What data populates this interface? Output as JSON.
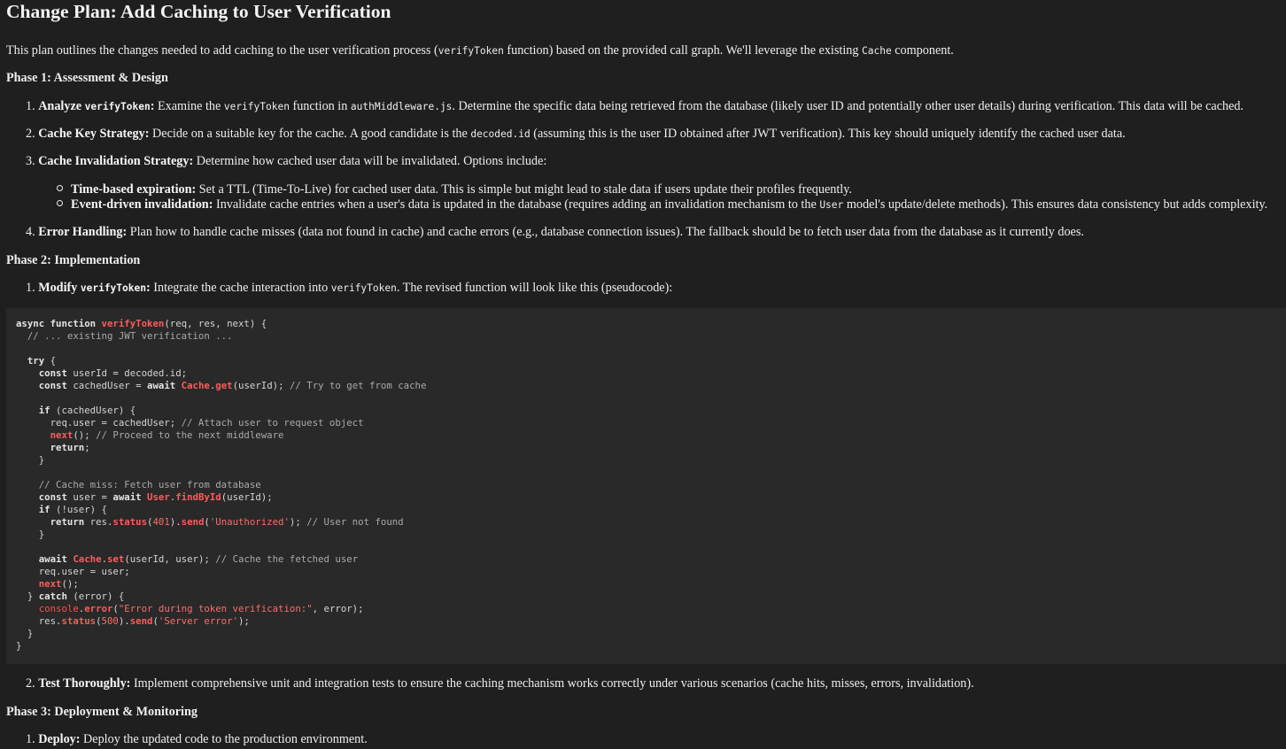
{
  "title": "Change Plan: Add Caching to User Verification",
  "intro": {
    "before": "This plan outlines the changes needed to add caching to the user verification process (",
    "code": "verifyToken",
    "after": " function) based on the provided call graph. We'll leverage the existing ",
    "code2": "Cache",
    "after2": " component."
  },
  "phase1": {
    "heading": "Phase 1: Assessment & Design",
    "items": [
      {
        "num": "1.",
        "label": "Analyze ",
        "label_code": "verifyToken",
        "label_end": ":",
        "t1": " Examine the ",
        "c1": "verifyToken",
        "t2": " function in ",
        "c2": "authMiddleware.js",
        "t3": ". Determine the specific data being retrieved from the database (likely user ID and potentially other user details) during verification. This data will be cached."
      },
      {
        "num": "2.",
        "label": "Cache Key Strategy:",
        "t1": " Decide on a suitable key for the cache. A good candidate is the ",
        "c1": "decoded.id",
        "t2": " (assuming this is the user ID obtained after JWT verification). This key should uniquely identify the cached user data."
      },
      {
        "num": "3.",
        "label": "Cache Invalidation Strategy:",
        "t1": " Determine how cached user data will be invalidated. Options include:",
        "bullets": [
          {
            "label": "Time-based expiration:",
            "text": " Set a TTL (Time-To-Live) for cached user data. This is simple but might lead to stale data if users update their profiles frequently."
          },
          {
            "label": "Event-driven invalidation:",
            "text": " Invalidate cache entries when a user's data is updated in the database (requires adding an invalidation mechanism to the ",
            "code": "User",
            "text2": " model's update/delete methods). This ensures data consistency but adds complexity."
          }
        ]
      },
      {
        "num": "4.",
        "label": "Error Handling:",
        "t1": " Plan how to handle cache misses (data not found in cache) and cache errors (e.g., database connection issues). The fallback should be to fetch user data from the database as it currently does."
      }
    ]
  },
  "phase2": {
    "heading": "Phase 2: Implementation",
    "item1": {
      "num": "1.",
      "label": "Modify ",
      "label_code": "verifyToken",
      "label_end": ":",
      "t1": " Integrate the cache interaction into ",
      "c1": "verifyToken",
      "t2": ". The revised function will look like this (pseudocode):"
    },
    "item2": {
      "num": "2.",
      "label": "Test Thoroughly:",
      "t1": " Implement comprehensive unit and integration tests to ensure the caching mechanism works correctly under various scenarios (cache hits, misses, errors, invalidation)."
    }
  },
  "phase3": {
    "heading": "Phase 3: Deployment & Monitoring",
    "item1": {
      "num": "1.",
      "label": "Deploy:",
      "t1": " Deploy the updated code to the production environment."
    }
  },
  "code_lines": [
    "async function verifyToken(req, res, next) {",
    "  // ... existing JWT verification ...",
    "",
    "  try {",
    "    const userId = decoded.id;",
    "    const cachedUser = await Cache.get(userId); // Try to get from cache",
    "",
    "    if (cachedUser) {",
    "      req.user = cachedUser; // Attach user to request object",
    "      next(); // Proceed to the next middleware",
    "      return;",
    "    }",
    "",
    "    // Cache miss: Fetch user from database",
    "    const user = await User.findById(userId);",
    "    if (!user) {",
    "      return res.status(401).send('Unauthorized'); // User not found",
    "    }",
    "",
    "    await Cache.set(userId, user); // Cache the fetched user",
    "    req.user = user;",
    "    next();",
    "  } catch (error) {",
    "    console.error(\"Error during token verification:\", error);",
    "    res.status(500).send('Server error');",
    "  }",
    "}"
  ]
}
